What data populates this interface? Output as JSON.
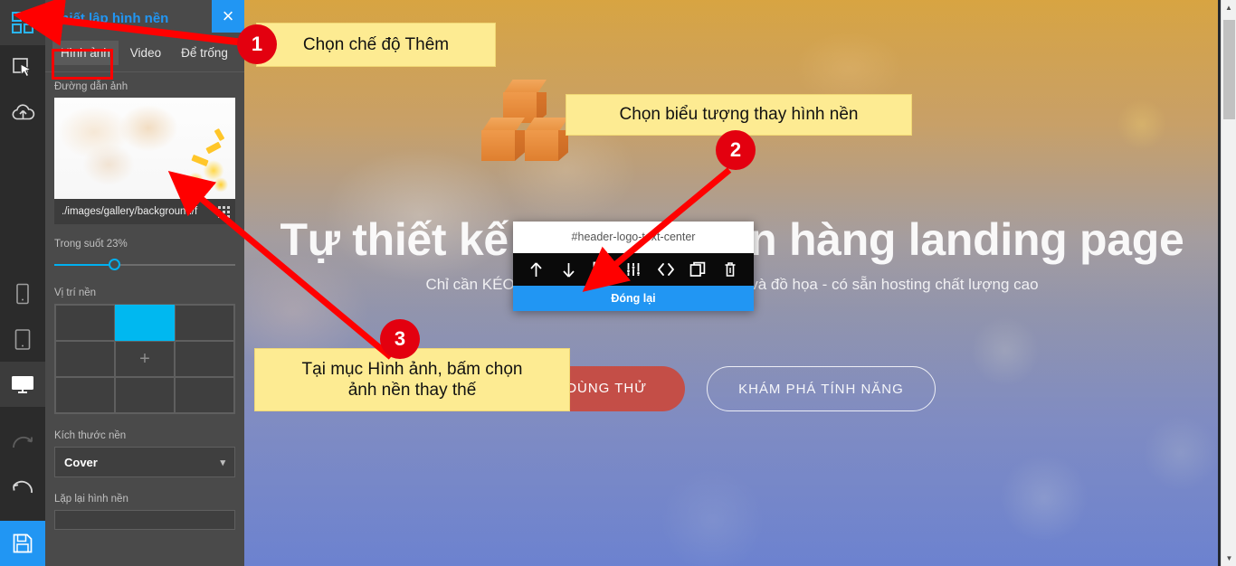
{
  "app": {
    "rail": {
      "add_blocks_icon": "grid-plus-icon",
      "items": [
        {
          "name": "select",
          "icon": "pointer-select-icon",
          "active": false
        },
        {
          "name": "upload",
          "icon": "cloud-upload-icon",
          "active": false
        },
        {
          "name": "mobile-view",
          "icon": "mobile-icon",
          "active": false
        },
        {
          "name": "tablet-view",
          "icon": "tablet-icon",
          "active": false
        },
        {
          "name": "desktop-view",
          "icon": "desktop-icon",
          "active": true
        },
        {
          "name": "redo",
          "icon": "redo-icon",
          "active": false
        },
        {
          "name": "undo",
          "icon": "undo-icon",
          "active": false
        }
      ],
      "save_icon": "floppy-save-icon"
    },
    "panel": {
      "title": "Thiết lập hình nền",
      "close_label": "×",
      "tabs": [
        {
          "label": "Hình ảnh",
          "active": true
        },
        {
          "label": "Video",
          "active": false
        },
        {
          "label": "Để trống",
          "active": false
        }
      ],
      "image_path_label": "Đường dẫn ảnh",
      "image_path_value": "./images/gallery/background/f",
      "grip_icon": "grid-dots-icon",
      "opacity_label": "Trong suốt 23%",
      "opacity_value": 23,
      "position_label": "Vị trí nền",
      "position_selected_index": 1,
      "position_plus_icon": "plus-icon",
      "size_label": "Kích thước nền",
      "size_value": "Cover",
      "size_chevron_icon": "chevron-down-icon",
      "repeat_label": "Lặp lại hình nền",
      "accent_color": "#2196f3",
      "highlight_color": "#00b8f0"
    },
    "toolbar_popup": {
      "selector_name": "#header-logo-text-center",
      "icons": [
        {
          "name": "move-up-icon",
          "glyph": "↑"
        },
        {
          "name": "move-down-icon",
          "glyph": "↓"
        },
        {
          "name": "background-image-icon",
          "glyph": ""
        },
        {
          "name": "settings-sliders-icon",
          "glyph": ""
        },
        {
          "name": "code-view-icon",
          "glyph": "〈〉"
        },
        {
          "name": "duplicate-icon",
          "glyph": ""
        },
        {
          "name": "delete-icon",
          "glyph": ""
        }
      ],
      "close_label": "Đóng lại",
      "close_color": "#2196f3"
    },
    "page": {
      "logo_icon": "orange-cubes-logo",
      "headline": "Tự thiết kế website bán hàng landing page",
      "subheadline": "Chỉ cần KÉO và THẢ - Không cần biết lập trình và đồ họa - có sẵn hosting chất lượng cao",
      "primary_button": "DÙNG THỬ",
      "secondary_button": "KHÁM PHÁ TÍNH NĂNG",
      "primary_color": "#cd4637"
    },
    "annotations": [
      {
        "number": "1",
        "text": "Chọn chế độ Thêm"
      },
      {
        "number": "2",
        "text": "Chọn biểu tượng thay hình nền"
      },
      {
        "number": "3",
        "text": "Tại mục Hình ảnh, bấm chọn\nảnh nền thay thế"
      }
    ],
    "scrollbar": {
      "up_arrow_icon": "caret-up-icon",
      "down_arrow_icon": "caret-down-icon"
    }
  }
}
